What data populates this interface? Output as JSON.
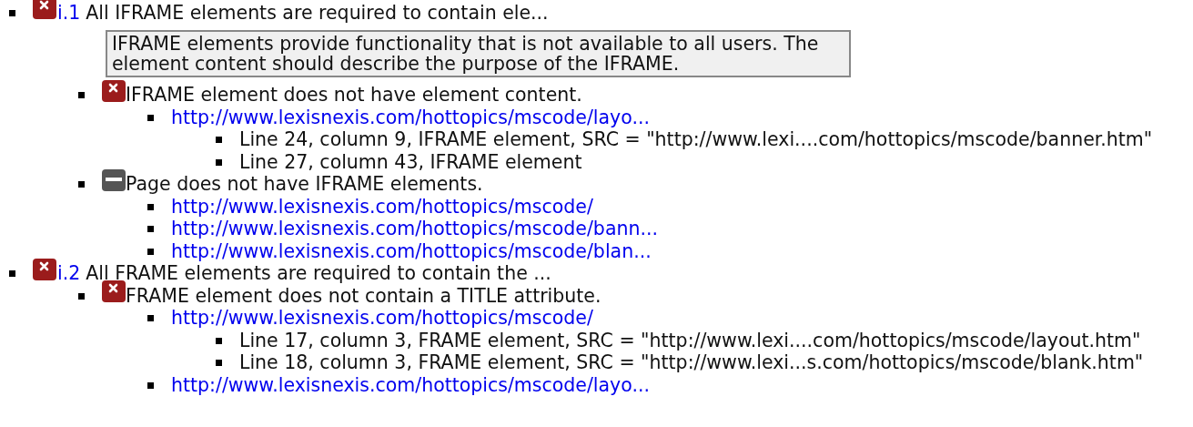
{
  "rules": [
    {
      "kind": "fail",
      "id": "i.1",
      "title": "All IFRAME elements are required to contain ele...",
      "description": "IFRAME elements provide functionality that is not available to all users. The element content should describe the purpose of the IFRAME.",
      "checks": [
        {
          "kind": "fail",
          "text": "IFRAME element does not have element content.",
          "pages": [
            {
              "url": "http://www.lexisnexis.com/hottopics/mscode/layo...",
              "locations": [
                "Line 24, column 9, IFRAME element, SRC = \"http://www.lexi....com/hottopics/mscode/banner.htm\"",
                "Line 27, column 43, IFRAME element"
              ]
            }
          ]
        },
        {
          "kind": "na",
          "text": "Page does not have IFRAME elements.",
          "pages": [
            {
              "url": "http://www.lexisnexis.com/hottopics/mscode/"
            },
            {
              "url": "http://www.lexisnexis.com/hottopics/mscode/bann..."
            },
            {
              "url": "http://www.lexisnexis.com/hottopics/mscode/blan..."
            }
          ]
        }
      ]
    },
    {
      "kind": "fail",
      "id": "i.2",
      "title": "All FRAME elements are required to contain the ...",
      "checks": [
        {
          "kind": "fail",
          "text": "FRAME element does not contain a TITLE attribute.",
          "pages": [
            {
              "url": "http://www.lexisnexis.com/hottopics/mscode/",
              "locations": [
                "Line 17, column 3, FRAME element, SRC = \"http://www.lexi....com/hottopics/mscode/layout.htm\"",
                "Line 18, column 3, FRAME element, SRC = \"http://www.lexi...s.com/hottopics/mscode/blank.htm\""
              ]
            },
            {
              "url": "http://www.lexisnexis.com/hottopics/mscode/layo..."
            }
          ]
        }
      ]
    }
  ]
}
